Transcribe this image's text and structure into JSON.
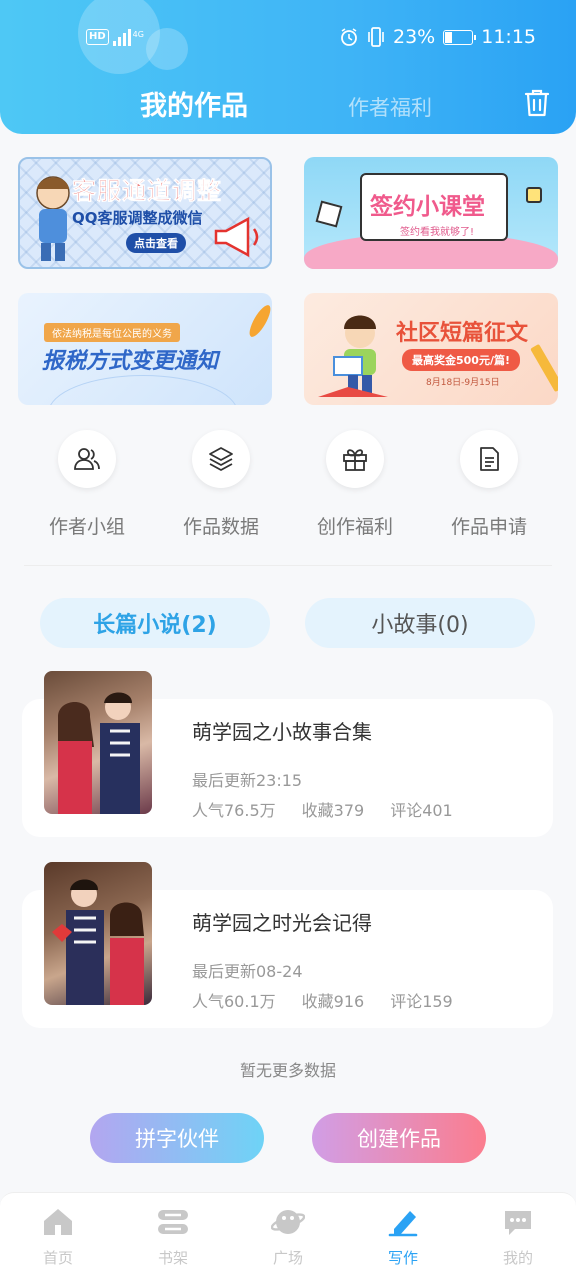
{
  "status_bar": {
    "left_badge": "HD",
    "network": "4G",
    "battery": "23%",
    "battery_level": 0.23,
    "time": "11:15"
  },
  "header": {
    "active_tab": "我的作品",
    "other_tab": "作者福利",
    "trash_icon": "trash-icon"
  },
  "banners": [
    {
      "title": "客服通道调整",
      "subtitle": "QQ客服调整成微信",
      "cta": "点击查看"
    },
    {
      "title": "签约小课堂",
      "subtitle": "签约看我就够了!"
    },
    {
      "title": "报税方式变更通知",
      "subtitle": "依法纳税是每位公民的义务"
    },
    {
      "title": "社区短篇征文",
      "subtitle": "最高奖金500元/篇!",
      "note": "8月18日-9月15日"
    }
  ],
  "quick_menu": [
    {
      "label": "作者小组",
      "icon": "group-icon"
    },
    {
      "label": "作品数据",
      "icon": "layers-icon"
    },
    {
      "label": "创作福利",
      "icon": "gift-icon"
    },
    {
      "label": "作品申请",
      "icon": "document-icon"
    }
  ],
  "categories": [
    {
      "label": "长篇小说(2)",
      "active": true
    },
    {
      "label": "小故事(0)",
      "active": false
    }
  ],
  "works": [
    {
      "title": "萌学园之小故事合集",
      "update": "最后更新23:15",
      "popularity": "人气76.5万",
      "favorites": "收藏379",
      "comments": "评论401"
    },
    {
      "title": "萌学园之时光会记得",
      "update": "最后更新08-24",
      "popularity": "人气60.1万",
      "favorites": "收藏916",
      "comments": "评论159"
    }
  ],
  "no_more": "暂无更多数据",
  "buttons": {
    "partner": "拼字伙伴",
    "create": "创建作品"
  },
  "bottom_nav": [
    {
      "label": "首页",
      "icon": "home-icon",
      "active": false
    },
    {
      "label": "书架",
      "icon": "bookshelf-icon",
      "active": false
    },
    {
      "label": "广场",
      "icon": "planet-icon",
      "active": false
    },
    {
      "label": "写作",
      "icon": "pen-icon",
      "active": true
    },
    {
      "label": "我的",
      "icon": "chat-icon",
      "active": false
    }
  ],
  "colors": {
    "accent": "#2aa2f4",
    "header_start": "#4ec8f5",
    "nav_inactive": "#c8c8c8"
  }
}
